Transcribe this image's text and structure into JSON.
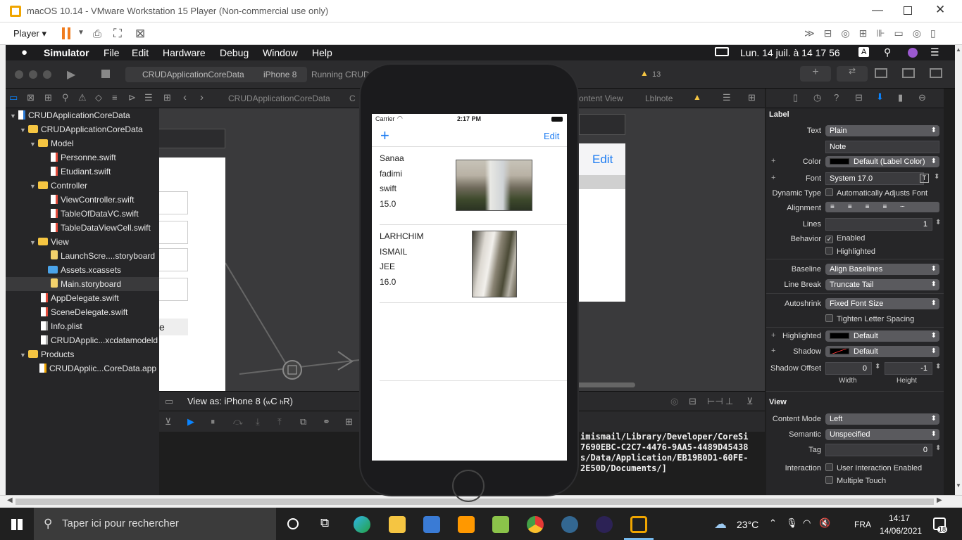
{
  "vmware": {
    "title": "macOS 10.14 - VMware Workstation 15 Player (Non-commercial use only)",
    "player_menu": "Player",
    "window_controls": [
      "minimize-icon",
      "maximize-icon",
      "close-icon"
    ]
  },
  "mac_menubar": {
    "app": "Simulator",
    "items": [
      "File",
      "Edit",
      "Hardware",
      "Debug",
      "Window",
      "Help"
    ],
    "clock": "Lun. 14 juil. à  14 17 56",
    "input_source": "A"
  },
  "xcode_toolbar": {
    "scheme": "CRUDApplicationCoreData",
    "device": "iPhone 8",
    "status": "Running CRUD",
    "warnings": "13"
  },
  "jump_bar": {
    "path1": "CRUDApplicationCoreData",
    "path2": "C",
    "path3": "ontent View",
    "path4": "Lblnote"
  },
  "navigator": {
    "items": [
      {
        "label": "CRUDApplicationCoreData",
        "type": "project",
        "indent": 0
      },
      {
        "label": "CRUDApplicationCoreData",
        "type": "folder",
        "indent": 1
      },
      {
        "label": "Model",
        "type": "folder",
        "indent": 2
      },
      {
        "label": "Personne.swift",
        "type": "file",
        "indent": 3
      },
      {
        "label": "Etudiant.swift",
        "type": "file",
        "indent": 3
      },
      {
        "label": "Controller",
        "type": "folder",
        "indent": 2
      },
      {
        "label": "ViewController.swift",
        "type": "file",
        "indent": 3
      },
      {
        "label": "TableOfDataVC.swift",
        "type": "file",
        "indent": 3
      },
      {
        "label": "TableDataViewCell.swift",
        "type": "file",
        "indent": 3
      },
      {
        "label": "View",
        "type": "folder",
        "indent": 2
      },
      {
        "label": "LaunchScre....storyboard",
        "type": "storyboard",
        "indent": 3
      },
      {
        "label": "Assets.xcassets",
        "type": "assets",
        "indent": 3
      },
      {
        "label": "Main.storyboard",
        "type": "storyboard",
        "indent": 3,
        "selected": true
      },
      {
        "label": "AppDelegate.swift",
        "type": "file",
        "indent": 2
      },
      {
        "label": "SceneDelegate.swift",
        "type": "file",
        "indent": 2
      },
      {
        "label": "Info.plist",
        "type": "plist",
        "indent": 2
      },
      {
        "label": "CRUDApplic...xcdatamodeld",
        "type": "model",
        "indent": 2
      },
      {
        "label": "Products",
        "type": "folder",
        "indent": 1
      },
      {
        "label": "CRUDApplic...CoreData.app",
        "type": "app",
        "indent": 2
      }
    ]
  },
  "canvas": {
    "edit_label": "Edit",
    "partial_e": "e",
    "view_as": "View as: iPhone 8 (",
    "view_as_w": "w",
    "view_as_c": "C ",
    "view_as_h": "h",
    "view_as_r": "R)"
  },
  "console": {
    "lines": [
      "imismail/Library/Developer/CoreSi",
      "7690EBC-C2C7-4476-9AA5-4489D45438",
      "s/Data/Application/EB19B0D1-60FE-",
      "2E50D/Documents/]"
    ]
  },
  "simulator": {
    "carrier": "Carrier",
    "time": "2:17 PM",
    "add_button": "+",
    "edit_button": "Edit",
    "rows": [
      {
        "lines": [
          "Sanaa",
          "fadimi",
          "swift",
          "15.0"
        ],
        "image": "waterfall-landscape"
      },
      {
        "lines": [
          "LARHCHIM",
          "ISMAIL",
          "JEE",
          "16.0"
        ],
        "image": "waterfall-closeup"
      }
    ]
  },
  "inspector": {
    "section_label": "Label",
    "text_label": "Text",
    "text_value": "Plain",
    "note_value": "Note",
    "color_label": "Color",
    "color_value": "Default (Label Color)",
    "font_label": "Font",
    "font_value": "System 17.0",
    "dynamic_type_label": "Dynamic Type",
    "dynamic_type_value": "Automatically Adjusts Font",
    "alignment_label": "Alignment",
    "lines_label": "Lines",
    "lines_value": "1",
    "behavior_label": "Behavior",
    "enabled_label": "Enabled",
    "highlighted_chk_label": "Highlighted",
    "baseline_label": "Baseline",
    "baseline_value": "Align Baselines",
    "line_break_label": "Line Break",
    "line_break_value": "Truncate Tail",
    "autoshrink_label": "Autoshrink",
    "autoshrink_value": "Fixed Font Size",
    "tighten_label": "Tighten Letter Spacing",
    "highlighted_label": "Highlighted",
    "highlighted_value": "Default",
    "shadow_label": "Shadow",
    "shadow_value": "Default",
    "shadow_offset_label": "Shadow Offset",
    "shadow_width": "0",
    "shadow_height": "-1",
    "width_label": "Width",
    "height_label": "Height",
    "view_section": "View",
    "content_mode_label": "Content Mode",
    "content_mode_value": "Left",
    "semantic_label": "Semantic",
    "semantic_value": "Unspecified",
    "tag_label": "Tag",
    "tag_value": "0",
    "interaction_label": "Interaction",
    "user_interaction_label": "User Interaction Enabled",
    "multiple_touch_label": "Multiple Touch"
  },
  "taskbar": {
    "search_placeholder": "Taper ici pour rechercher",
    "weather": "23°C",
    "language": "FRA",
    "time": "14:17",
    "date": "14/06/2021",
    "notifications": "18"
  },
  "colors": {
    "accent": "#0a84ff",
    "ios_blue": "#1d7cf2",
    "folder": "#f5c542",
    "swift": "#e34c3c",
    "warning": "#f5c542"
  }
}
